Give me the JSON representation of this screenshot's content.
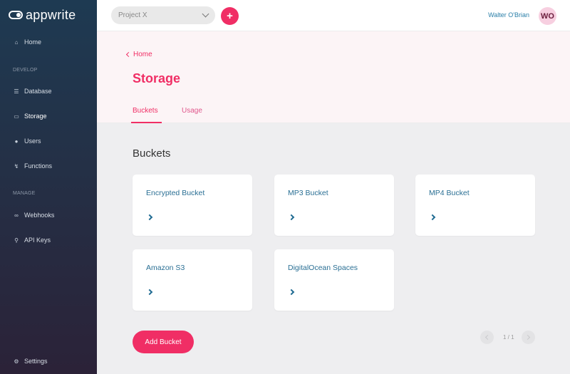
{
  "brand": {
    "logo_text": "appwrite"
  },
  "sidebar": {
    "items": [
      {
        "label": "Home",
        "icon": "home-icon"
      },
      {
        "label": "Database",
        "icon": "database-icon"
      },
      {
        "label": "Storage",
        "icon": "folder-icon"
      },
      {
        "label": "Users",
        "icon": "users-icon"
      },
      {
        "label": "Functions",
        "icon": "bolt-icon"
      },
      {
        "label": "Webhooks",
        "icon": "link-icon"
      },
      {
        "label": "API Keys",
        "icon": "key-icon"
      },
      {
        "label": "Settings",
        "icon": "gear-icon"
      }
    ],
    "sections": {
      "develop": "DEVELOP",
      "manage": "MANAGE"
    }
  },
  "topbar": {
    "project": "Project X",
    "add_label": "+",
    "user_name": "Walter O'Brian",
    "avatar_initials": "WO"
  },
  "header": {
    "back_label": "Home",
    "title": "Storage",
    "tabs": [
      {
        "label": "Buckets",
        "active": true
      },
      {
        "label": "Usage",
        "active": false
      }
    ]
  },
  "main": {
    "section_title": "Buckets",
    "buckets": [
      {
        "name": "Encrypted Bucket"
      },
      {
        "name": "MP3 Bucket"
      },
      {
        "name": "MP4 Bucket"
      },
      {
        "name": "Amazon S3"
      },
      {
        "name": "DigitalOcean Spaces"
      }
    ],
    "add_button": "Add Bucket",
    "pagination": "1 / 1"
  },
  "colors": {
    "accent": "#f02e65",
    "link": "#2a6f94",
    "sidebar_top": "#1e3a52",
    "sidebar_bottom": "#2b2238"
  }
}
